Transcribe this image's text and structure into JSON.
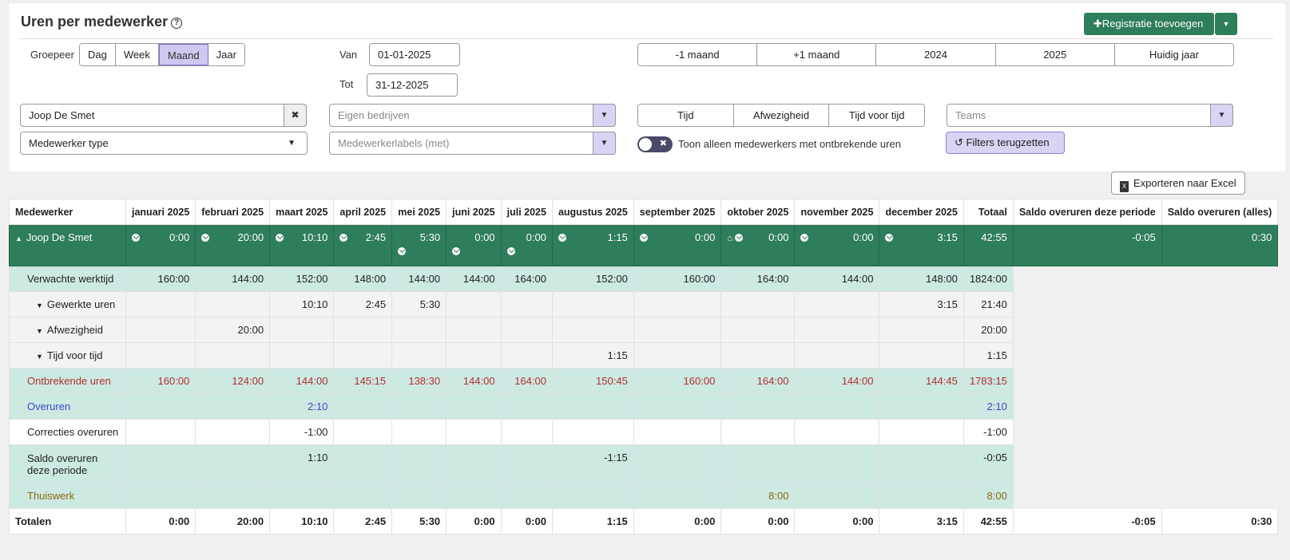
{
  "header": {
    "title": "Uren per medewerker",
    "add_button": "Registratie toevoegen",
    "add_dropdown_icon": "caret-down-icon",
    "help_icon": "question-icon"
  },
  "filters": {
    "group_label": "Groepeer",
    "group_options": [
      "Dag",
      "Week",
      "Maand",
      "Jaar"
    ],
    "group_selected": "Maand",
    "van_label": "Van",
    "van_value": "01-01-2025",
    "tot_label": "Tot",
    "tot_value": "31-12-2025",
    "period_buttons": [
      "-1 maand",
      "+1 maand",
      "2024",
      "2025",
      "Huidig jaar"
    ],
    "employee_value": "Joop De Smet",
    "companies_placeholder": "Eigen bedrijven",
    "type_buttons": [
      "Tijd",
      "Afwezigheid",
      "Tijd voor tijd"
    ],
    "teams_placeholder": "Teams",
    "employee_type_value": "Medewerker type",
    "labels_placeholder": "Medewerkerlabels (met)",
    "toggle_label": "Toon alleen medewerkers met ontbrekende uren",
    "reset_button": "Filters terugzetten"
  },
  "export_button": "Exporteren naar Excel",
  "table": {
    "headers": [
      "Medewerker",
      "januari 2025",
      "februari 2025",
      "maart 2025",
      "april 2025",
      "mei 2025",
      "juni 2025",
      "juli 2025",
      "augustus 2025",
      "september 2025",
      "oktober 2025",
      "november 2025",
      "december 2025",
      "Totaal",
      "Saldo overuren deze periode",
      "Saldo overuren (alles)"
    ],
    "employee": {
      "name": "Joop De Smet",
      "values": [
        "0:00",
        "20:00",
        "10:10",
        "2:45",
        "5:30",
        "0:00",
        "0:00",
        "1:15",
        "0:00",
        "0:00",
        "0:00",
        "3:15"
      ],
      "total": "42:55",
      "saldo_periode": "-0:05",
      "saldo_alles": "0:30"
    },
    "rows": [
      {
        "label": "Verwachte werktijd",
        "values": [
          "160:00",
          "144:00",
          "152:00",
          "148:00",
          "144:00",
          "144:00",
          "164:00",
          "152:00",
          "160:00",
          "164:00",
          "144:00",
          "148:00"
        ],
        "total": "1824:00"
      },
      {
        "label": "Gewerkte uren",
        "values": [
          "",
          "",
          "10:10",
          "2:45",
          "5:30",
          "",
          "",
          "",
          "",
          "",
          "",
          "3:15"
        ],
        "total": "21:40"
      },
      {
        "label": "Afwezigheid",
        "values": [
          "",
          "20:00",
          "",
          "",
          "",
          "",
          "",
          "",
          "",
          "",
          "",
          ""
        ],
        "total": "20:00"
      },
      {
        "label": "Tijd voor tijd",
        "values": [
          "",
          "",
          "",
          "",
          "",
          "",
          "",
          "1:15",
          "",
          "",
          "",
          ""
        ],
        "total": "1:15"
      },
      {
        "label": "Ontbrekende uren",
        "values": [
          "160:00",
          "124:00",
          "144:00",
          "145:15",
          "138:30",
          "144:00",
          "164:00",
          "150:45",
          "160:00",
          "164:00",
          "144:00",
          "144:45"
        ],
        "total": "1783:15"
      },
      {
        "label": "Overuren",
        "values": [
          "",
          "",
          "2:10",
          "",
          "",
          "",
          "",
          "",
          "",
          "",
          "",
          ""
        ],
        "total": "2:10"
      },
      {
        "label": "Correcties overuren",
        "values": [
          "",
          "",
          "-1:00",
          "",
          "",
          "",
          "",
          "",
          "",
          "",
          "",
          ""
        ],
        "total": "-1:00"
      },
      {
        "label": "Saldo overuren deze periode",
        "values": [
          "",
          "",
          "1:10",
          "",
          "",
          "",
          "",
          "-1:15",
          "",
          "",
          "",
          ""
        ],
        "total": "-0:05"
      },
      {
        "label": "Thuiswerk",
        "values": [
          "",
          "",
          "",
          "",
          "",
          "",
          "",
          "",
          "",
          "8:00",
          "",
          ""
        ],
        "total": "8:00"
      }
    ],
    "totals": {
      "label": "Totalen",
      "values": [
        "0:00",
        "20:00",
        "10:10",
        "2:45",
        "5:30",
        "0:00",
        "0:00",
        "1:15",
        "0:00",
        "0:00",
        "0:00",
        "3:15"
      ],
      "total": "42:55",
      "saldo_periode": "-0:05",
      "saldo_alles": "0:30"
    }
  },
  "colors": {
    "primary": "#2e7d5b",
    "accent": "#cfc8f0",
    "teal_row": "#cce9e2",
    "missing": "#b23030",
    "overtime": "#3a4bc0",
    "homework": "#8a6a12"
  }
}
